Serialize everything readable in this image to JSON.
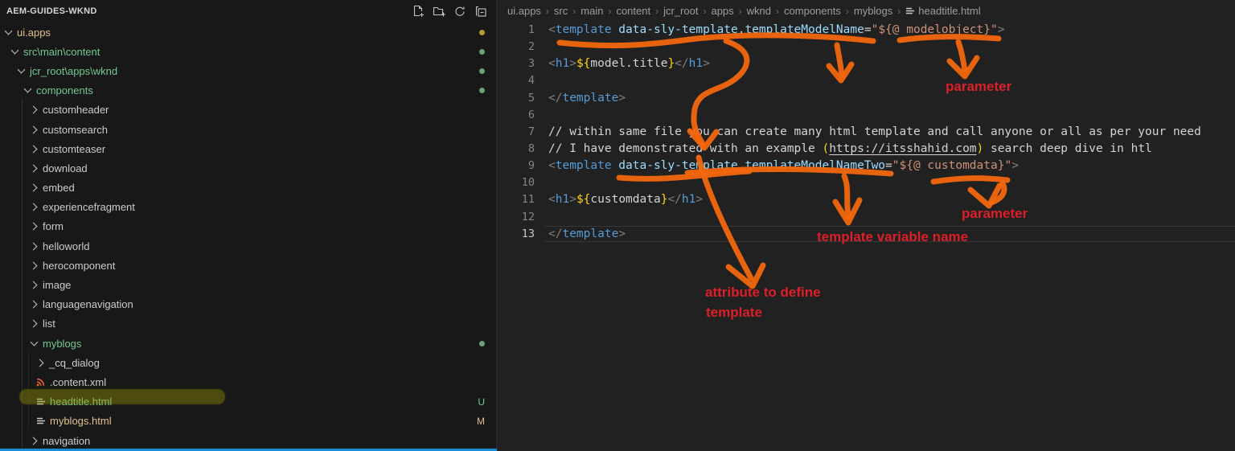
{
  "sidebar": {
    "title": "AEM-GUIDES-WKND",
    "actions": {
      "new_file": "New File",
      "new_folder": "New Folder",
      "refresh": "Refresh Explorer",
      "collapse_all": "Collapse Folders"
    },
    "items": [
      {
        "label": "ui.apps"
      },
      {
        "label": "src\\main\\content"
      },
      {
        "label": "jcr_root\\apps\\wknd"
      },
      {
        "label": "components"
      },
      {
        "label": "customheader"
      },
      {
        "label": "customsearch"
      },
      {
        "label": "customteaser"
      },
      {
        "label": "download"
      },
      {
        "label": "embed"
      },
      {
        "label": "experiencefragment"
      },
      {
        "label": "form"
      },
      {
        "label": "helloworld"
      },
      {
        "label": "herocomponent"
      },
      {
        "label": "image"
      },
      {
        "label": "languagenavigation"
      },
      {
        "label": "list"
      },
      {
        "label": "myblogs"
      },
      {
        "label": "_cq_dialog"
      },
      {
        "label": ".content.xml"
      },
      {
        "label": "headtitle.html",
        "badge": "U"
      },
      {
        "label": "myblogs.html",
        "badge": "M"
      },
      {
        "label": "navigation"
      }
    ]
  },
  "editor": {
    "crumb_sep": "›",
    "breadcrumbs": [
      {
        "label": "ui.apps"
      },
      {
        "label": "src"
      },
      {
        "label": "main"
      },
      {
        "label": "content"
      },
      {
        "label": "jcr_root"
      },
      {
        "label": "apps"
      },
      {
        "label": "wknd"
      },
      {
        "label": "components"
      },
      {
        "label": "myblogs"
      },
      {
        "label": "headtitle.html"
      }
    ],
    "lines": [
      {
        "num": "1",
        "t0": "<",
        "t1": "template",
        "t2": " data-sly-template.templateModelName",
        "t3": "=",
        "t4": "\"${@ modelobject}\"",
        "t5": ">"
      },
      {
        "num": "2"
      },
      {
        "num": "3",
        "t0": "<",
        "t1": "h1",
        "t2": ">",
        "t3": "${",
        "t4": "model.title",
        "t5": "}",
        "t6": "</",
        "t7": "h1",
        "t8": ">"
      },
      {
        "num": "4"
      },
      {
        "num": "5",
        "t0": "</",
        "t1": "template",
        "t2": ">"
      },
      {
        "num": "6"
      },
      {
        "num": "7",
        "t0": "// within same file you can create many html template and call anyone or all as per your need"
      },
      {
        "num": "8",
        "t0": "// I have demonstrated with an example ",
        "t1": "(",
        "t2": "https://itsshahid.com",
        "t3": ")",
        "t4": " search deep dive in htl"
      },
      {
        "num": "9",
        "t0": "<",
        "t1": "template",
        "t2": " data-sly-template.templateModelNameTwo",
        "t3": "=",
        "t4": "\"${@ customdata}\"",
        "t5": ">"
      },
      {
        "num": "10"
      },
      {
        "num": "11",
        "t0": "<",
        "t1": "h1",
        "t2": ">",
        "t3": "${",
        "t4": "customdata",
        "t5": "}",
        "t6": "</",
        "t7": "h1",
        "t8": ">"
      },
      {
        "num": "12"
      },
      {
        "num": "13",
        "t0": "</",
        "t1": "template",
        "t2": ">"
      }
    ]
  },
  "annotations": {
    "param1": "parameter",
    "param2": "parameter",
    "tvn": "template variable name",
    "attr_line1": "attribute to define",
    "attr_line2": "template"
  },
  "colors": {
    "accent_orange": "#f2670d",
    "annotation_red": "#dc1f28",
    "highlight_marker": "#a8a000",
    "statusbar_blue": "#1b8bd6",
    "git_untracked_green": "#73c991",
    "git_modified_yellow": "#e2c08d",
    "tag_blue": "#569cd6",
    "attr_light_blue": "#9cdcfe",
    "string_orange": "#ce9178",
    "bracket_gold": "#ffd700"
  }
}
